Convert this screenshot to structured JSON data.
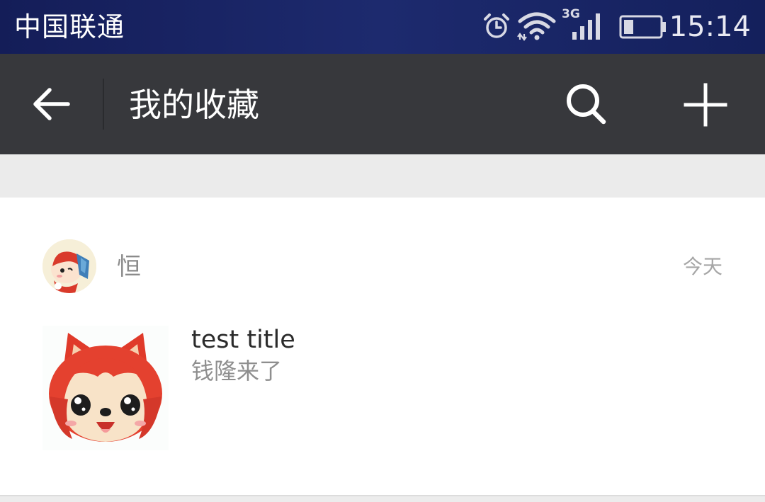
{
  "status_bar": {
    "carrier": "中国联通",
    "network_type": "3G",
    "time": "15:14",
    "icons": [
      "alarm-icon",
      "wifi-icon",
      "signal-icon",
      "battery-icon"
    ],
    "battery_level": 0.25
  },
  "toolbar": {
    "title": "我的收藏",
    "back_icon": "arrow-left-icon",
    "search_icon": "search-icon",
    "add_icon": "plus-icon"
  },
  "favorites": [
    {
      "user_name": "恒",
      "date": "今天",
      "title": "test title",
      "description": "钱隆来了"
    }
  ],
  "colors": {
    "status_bar": "#1a2466",
    "toolbar": "#37383c",
    "background": "#ebebeb",
    "card": "#ffffff"
  }
}
